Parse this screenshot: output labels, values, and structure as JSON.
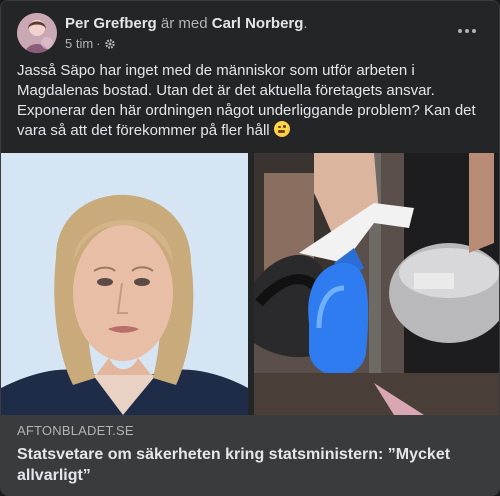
{
  "post": {
    "author": "Per Grefberg",
    "with_text": "är med",
    "tagged": "Carl Norberg",
    "period": ".",
    "time": "5 tim",
    "separator": "·",
    "privacy_icon": "gear-icon",
    "more_icon": "more-options-icon",
    "text": "Jasså Säpo har inget med de människor som utför arbeten i Magdalenas bostad. Utan det är det aktuella företagets ansvar. Exponerar den här ordningen något underliggande problem? Kan det vara så att det förekommer på fler håll",
    "emoji": "winking-face-emoji"
  },
  "link": {
    "domain": "AFTONBLADET.SE",
    "headline": "Statsvetare om säkerheten kring statsministern: ”Mycket allvarligt”"
  },
  "colors": {
    "card_bg": "#242526",
    "link_bg": "#3a3b3c",
    "text_primary": "#e4e6eb",
    "text_secondary": "#b0b3b8"
  }
}
